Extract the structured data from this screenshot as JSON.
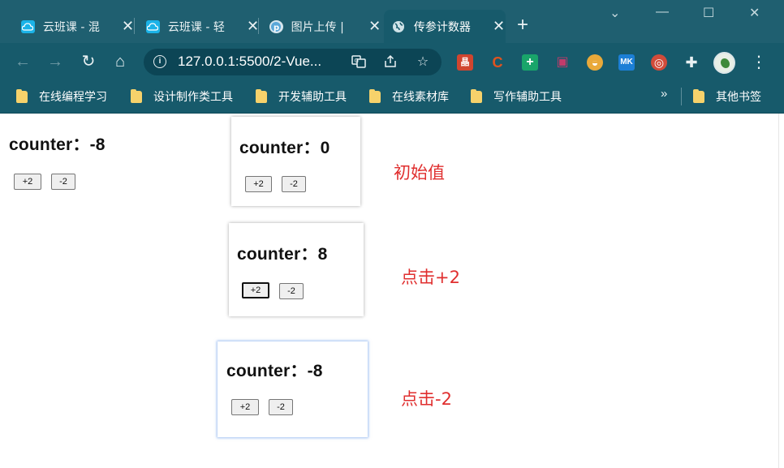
{
  "browser": {
    "tabs": [
      {
        "title": "云班课 - 混",
        "favicon_color": "#1bb3e8",
        "active": false
      },
      {
        "title": "云班课 - 轻",
        "favicon_color": "#1bb3e8",
        "active": false
      },
      {
        "title": "图片上传 |",
        "favicon_color": "#5aa7d8",
        "active": false
      },
      {
        "title": "传参计数器",
        "favicon_color": "#cfe3e8",
        "active": true
      }
    ],
    "new_tab_glyph": "+",
    "close_glyph": "✕",
    "window_controls": {
      "minimize": "—",
      "maximize": "☐",
      "close": "✕",
      "dropdown": "⌄"
    },
    "nav": {
      "back": "←",
      "forward": "→",
      "reload": "↻",
      "home": "⌂"
    },
    "address": {
      "url": "127.0.0.1:5500/2-Vue...",
      "info_glyph": "i"
    },
    "bookmarks": [
      {
        "label": "在线编程学习"
      },
      {
        "label": "设计制作类工具"
      },
      {
        "label": "开发辅助工具"
      },
      {
        "label": "在线素材库"
      },
      {
        "label": "写作辅助工具"
      }
    ],
    "bookmarks_overflow": "»",
    "other_bookmarks": "其他书签",
    "extensions": [
      {
        "name": "ext-red-icon",
        "color": "#d0452f",
        "glyph": "晶"
      },
      {
        "name": "ext-c-icon",
        "color": "#e0531f",
        "glyph": "C"
      },
      {
        "name": "ext-plus-icon",
        "color": "#19a56a",
        "glyph": "+"
      },
      {
        "name": "ext-tv-icon",
        "color": "#c23b6b",
        "glyph": "▣"
      },
      {
        "name": "ext-globe-icon",
        "color": "#e9a93a",
        "glyph": "◒"
      },
      {
        "name": "ext-mk-icon",
        "color": "#1c7fd6",
        "glyph": "MK"
      },
      {
        "name": "ext-chrome-icon",
        "color": "#d14b3a",
        "glyph": "◎"
      },
      {
        "name": "extensions-icon",
        "color": "transparent",
        "glyph": "✚"
      }
    ]
  },
  "page": {
    "main": {
      "counter_label": "counter：",
      "counter_value": "-8",
      "plus_label": "+2",
      "minus_label": "-2"
    },
    "snapshots": [
      {
        "counter_label": "counter：",
        "counter_value": "0",
        "plus_label": "+2",
        "minus_label": "-2",
        "annotation": "初始值"
      },
      {
        "counter_label": "counter：",
        "counter_value": "8",
        "plus_label": "+2",
        "minus_label": "-2",
        "annotation": "点击+2"
      },
      {
        "counter_label": "counter：",
        "counter_value": "-8",
        "plus_label": "+2",
        "minus_label": "-2",
        "annotation": "点击-2"
      }
    ],
    "annotation_color": "#e02f2f"
  }
}
